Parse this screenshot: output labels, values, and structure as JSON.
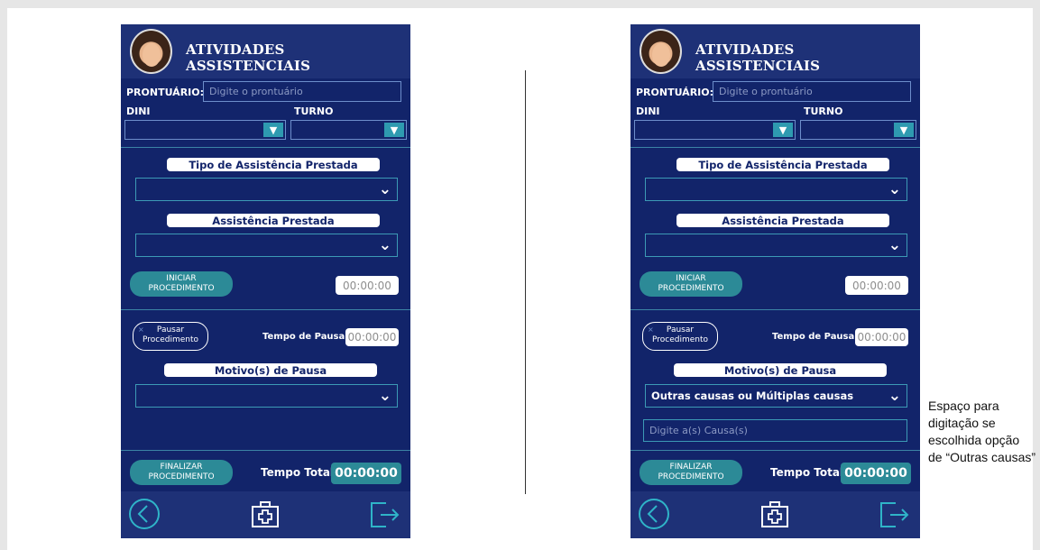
{
  "app": {
    "title": "ATIVIDADES ASSISTENCIAIS"
  },
  "form": {
    "prontuario_label": "PRONTUÁRIO:",
    "prontuario_placeholder": "Digite o prontuário",
    "dini_label": "DINI",
    "turno_label": "TURNO",
    "tipo_label": "Tipo de Assistência Prestada",
    "assist_label": "Assistência Prestada",
    "iniciar_btn": "INICIAR PROCEDIMENTO",
    "timer_inicio": "00:00:00",
    "pausar_btn": "Pausar Procedimento",
    "pausar_x": "×",
    "tempo_pausa_label": "Tempo de Pausa",
    "timer_pausa": "00:00:00",
    "motivo_label": "Motivo(s) de Pausa",
    "finalizar_btn": "FINALIZAR PROCEDIMENTO",
    "tempo_total_label": "Tempo Total",
    "timer_total": "00:00:00"
  },
  "right": {
    "motivo_value": "Outras causas ou Múltiplas causas",
    "causa_placeholder": "Digite a(s) Causa(s)"
  },
  "annotation": "Espaço para digitação se escolhida opção de “Outras causas”",
  "icons": {
    "back": "back-circle-icon",
    "medkit": "medical-kit-icon",
    "exit": "exit-icon",
    "chevron": "chevron-down-icon"
  }
}
